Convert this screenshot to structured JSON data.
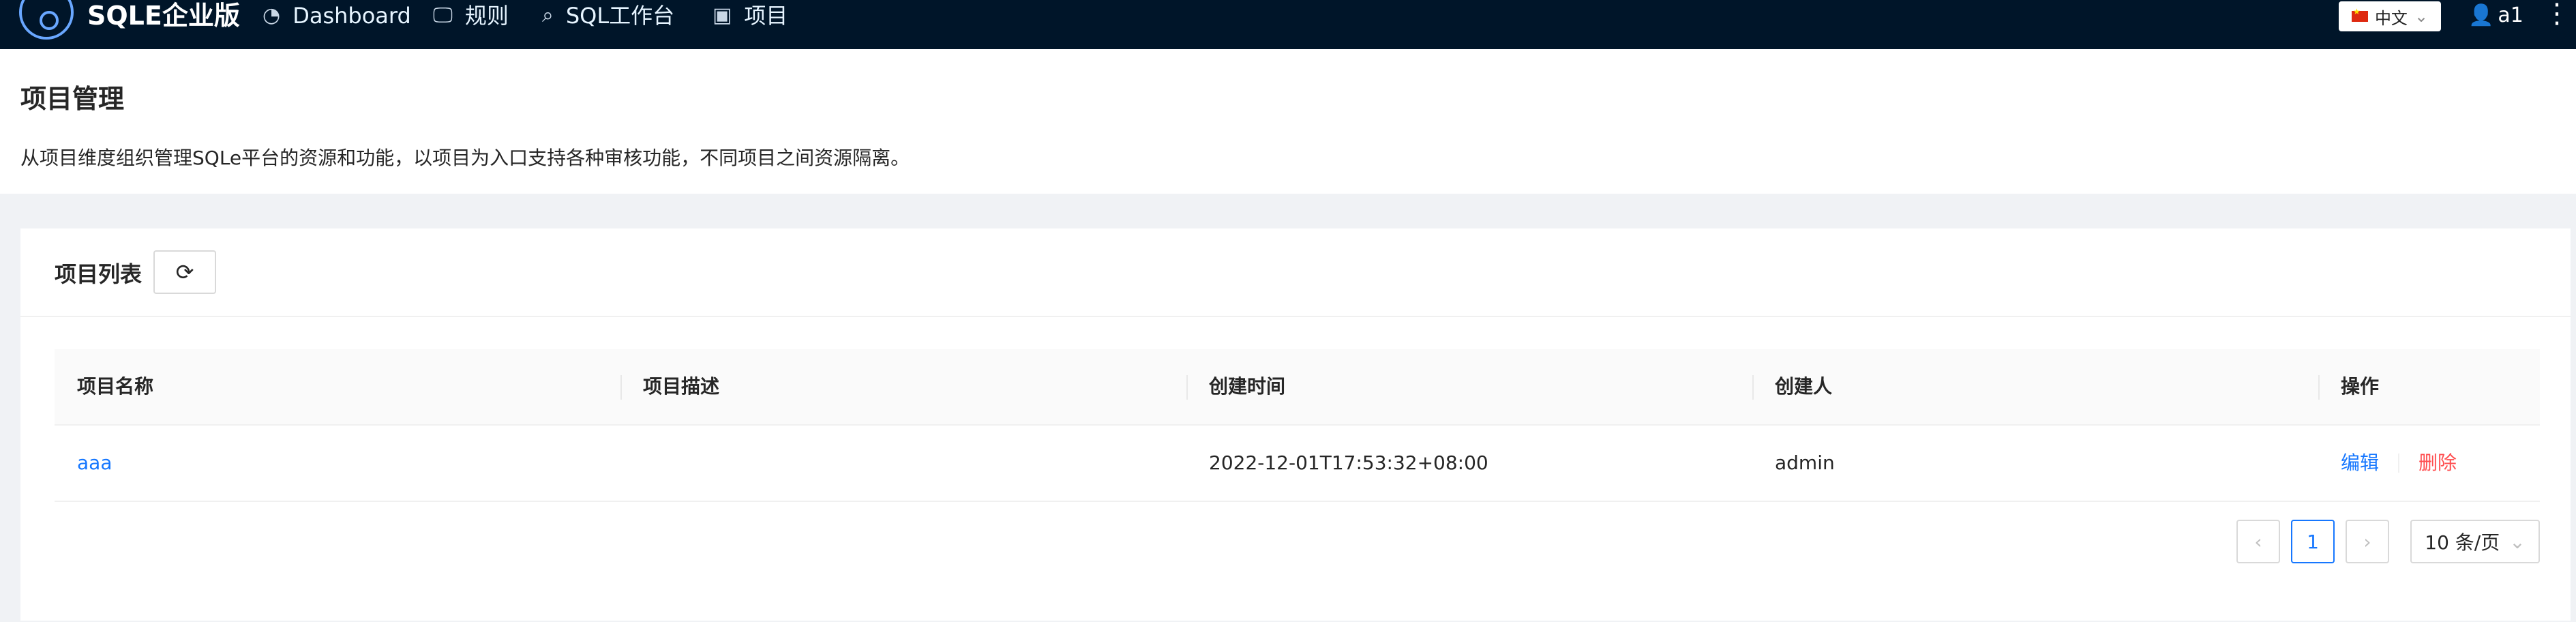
{
  "header": {
    "brand": "SQLE企业版",
    "nav": [
      {
        "label": "Dashboard",
        "icon": "pie-chart-icon"
      },
      {
        "label": "规则",
        "icon": "monitor-icon"
      },
      {
        "label": "SQL工作台",
        "icon": "search-icon"
      },
      {
        "label": "项目",
        "icon": "project-icon"
      }
    ],
    "language": "中文",
    "user": "a1"
  },
  "page": {
    "title": "项目管理",
    "description": "从项目维度组织管理SQLe平台的资源和功能，以项目为入口支持各种审核功能，不同项目之间资源隔离。"
  },
  "card": {
    "title": "项目列表"
  },
  "table": {
    "columns": [
      "项目名称",
      "项目描述",
      "创建时间",
      "创建人",
      "操作"
    ],
    "rows": [
      {
        "name": "aaa",
        "description": "",
        "created_at": "2022-12-01T17:53:32+08:00",
        "creator": "admin",
        "edit": "编辑",
        "delete": "删除"
      }
    ]
  },
  "pagination": {
    "current": "1",
    "page_size": "10 条/页"
  },
  "colors": {
    "header_bg": "#001529",
    "primary": "#1677ff",
    "danger": "#ff4d4f"
  }
}
